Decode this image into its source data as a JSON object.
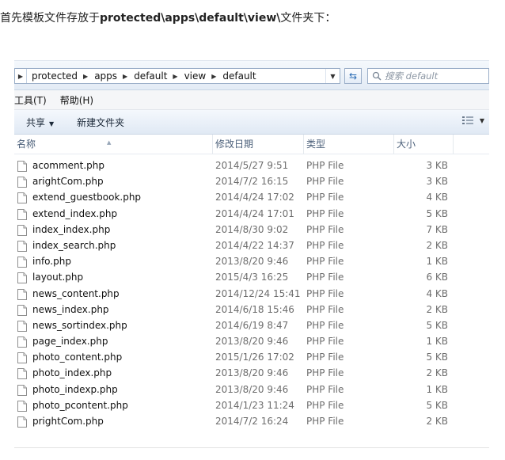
{
  "intro": {
    "pre": "首先模板文件存放于",
    "path": "protected\\apps\\default\\view\\",
    "post": "文件夹下："
  },
  "address": {
    "crumbs": [
      "protected",
      "apps",
      "default",
      "view",
      "default"
    ]
  },
  "search": {
    "placeholder": "搜索 default"
  },
  "menu": {
    "tools": "工具(T)",
    "help": "帮助(H)"
  },
  "toolbar": {
    "share": "共享",
    "new_folder": "新建文件夹"
  },
  "columns": {
    "name": "名称",
    "date": "修改日期",
    "type": "类型",
    "size": "大小"
  },
  "files": [
    {
      "name": "acomment.php",
      "date": "2014/5/27 9:51",
      "type": "PHP File",
      "size": "3 KB"
    },
    {
      "name": "arightCom.php",
      "date": "2014/7/2 16:15",
      "type": "PHP File",
      "size": "3 KB"
    },
    {
      "name": "extend_guestbook.php",
      "date": "2014/4/24 17:02",
      "type": "PHP File",
      "size": "4 KB"
    },
    {
      "name": "extend_index.php",
      "date": "2014/4/24 17:01",
      "type": "PHP File",
      "size": "5 KB"
    },
    {
      "name": "index_index.php",
      "date": "2014/8/30 9:02",
      "type": "PHP File",
      "size": "7 KB"
    },
    {
      "name": "index_search.php",
      "date": "2014/4/22 14:37",
      "type": "PHP File",
      "size": "2 KB"
    },
    {
      "name": "info.php",
      "date": "2013/8/20 9:46",
      "type": "PHP File",
      "size": "1 KB"
    },
    {
      "name": "layout.php",
      "date": "2015/4/3 16:25",
      "type": "PHP File",
      "size": "6 KB"
    },
    {
      "name": "news_content.php",
      "date": "2014/12/24 15:41",
      "type": "PHP File",
      "size": "4 KB"
    },
    {
      "name": "news_index.php",
      "date": "2014/6/18 15:46",
      "type": "PHP File",
      "size": "2 KB"
    },
    {
      "name": "news_sortindex.php",
      "date": "2014/6/19 8:47",
      "type": "PHP File",
      "size": "5 KB"
    },
    {
      "name": "page_index.php",
      "date": "2013/8/20 9:46",
      "type": "PHP File",
      "size": "1 KB"
    },
    {
      "name": "photo_content.php",
      "date": "2015/1/26 17:02",
      "type": "PHP File",
      "size": "5 KB"
    },
    {
      "name": "photo_index.php",
      "date": "2013/8/20 9:46",
      "type": "PHP File",
      "size": "2 KB"
    },
    {
      "name": "photo_indexp.php",
      "date": "2013/8/20 9:46",
      "type": "PHP File",
      "size": "1 KB"
    },
    {
      "name": "photo_pcontent.php",
      "date": "2014/1/23 11:24",
      "type": "PHP File",
      "size": "5 KB"
    },
    {
      "name": "prightCom.php",
      "date": "2014/7/2 16:24",
      "type": "PHP File",
      "size": "2 KB"
    }
  ]
}
